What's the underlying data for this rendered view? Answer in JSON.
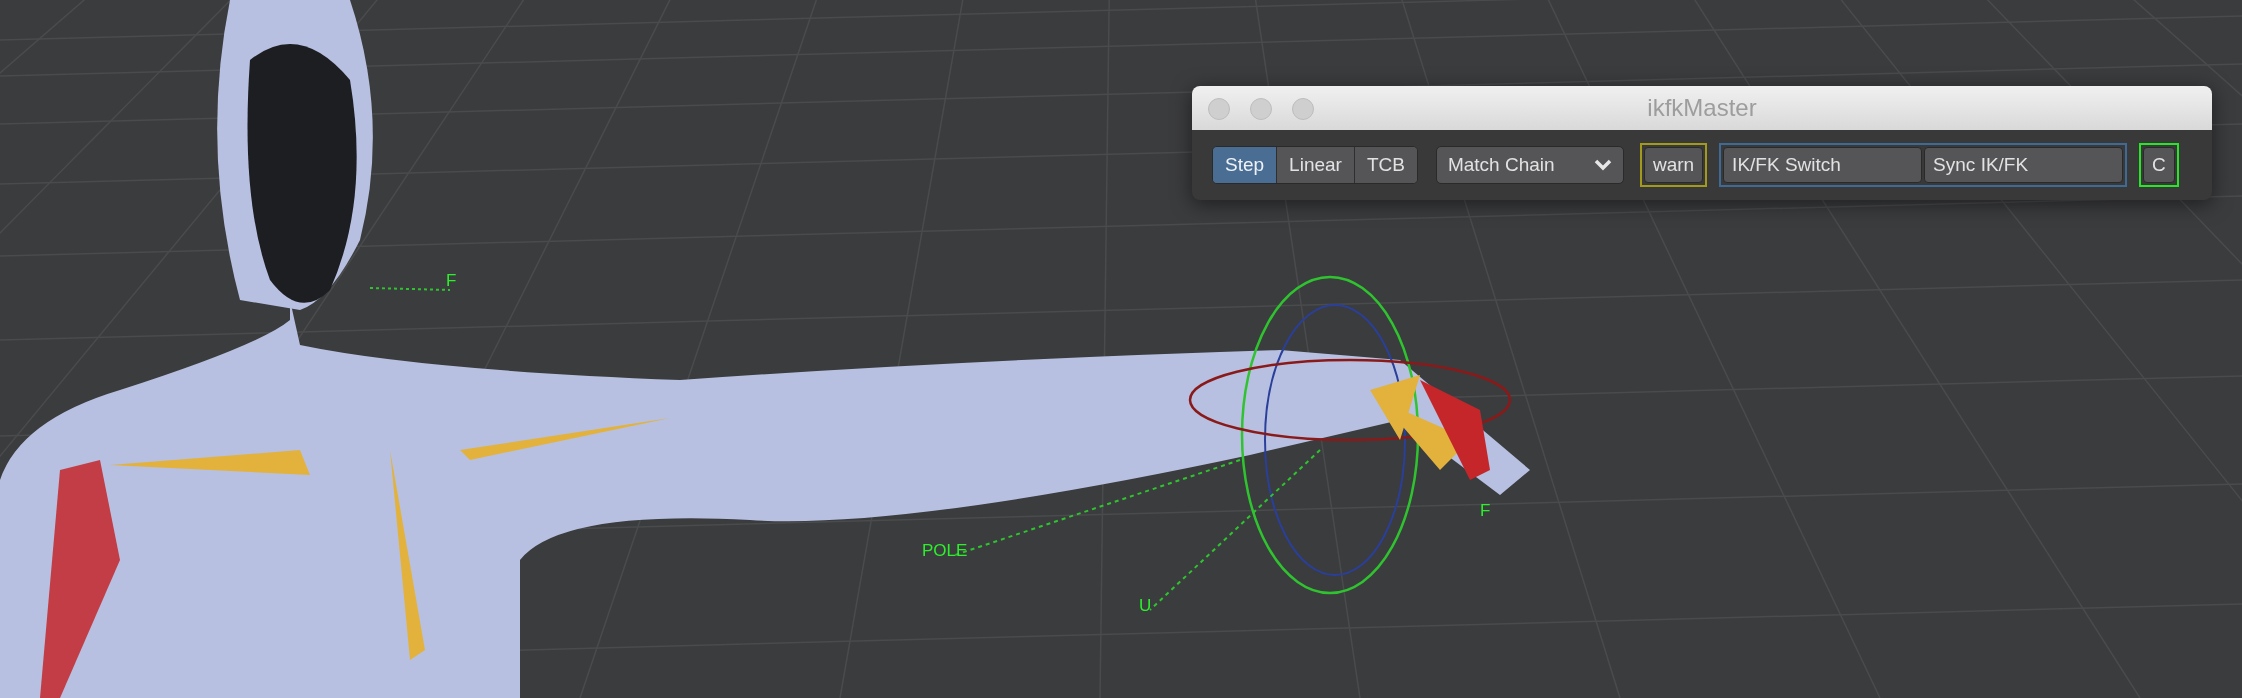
{
  "window": {
    "title": "ikfkMaster"
  },
  "toolbar": {
    "interpolation": [
      {
        "label": "Step",
        "selected": true
      },
      {
        "label": "Linear",
        "selected": false
      },
      {
        "label": "TCB",
        "selected": false
      }
    ],
    "dropdown": {
      "value": "Match Chain"
    },
    "groups": [
      {
        "color": "#a39a1c",
        "buttons": [
          "warn"
        ]
      },
      {
        "color": "#3f6a95",
        "buttons": [
          "IK/FK Switch",
          "Sync IK/FK"
        ]
      },
      {
        "color": "#27e627",
        "buttons": [
          "C"
        ]
      }
    ]
  },
  "viewport": {
    "labels": [
      "F",
      "POLE",
      "U",
      "F"
    ]
  }
}
